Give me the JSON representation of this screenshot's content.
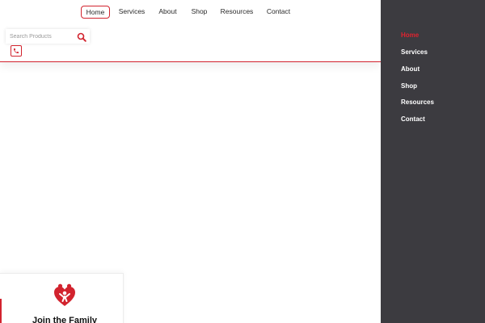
{
  "header": {
    "nav": [
      {
        "label": "Home",
        "active": true
      },
      {
        "label": "Services",
        "active": false
      },
      {
        "label": "About",
        "active": false
      },
      {
        "label": "Shop",
        "active": false
      },
      {
        "label": "Resources",
        "active": false
      },
      {
        "label": "Contact",
        "active": false
      }
    ],
    "search": {
      "placeholder": "Search Products",
      "value": "",
      "icon": "search-icon"
    },
    "phone_icon": "phone-icon"
  },
  "card": {
    "icon": "family-heart-icon",
    "title": "Join the Family"
  },
  "sidebar": {
    "items": [
      {
        "label": "Home",
        "active": true
      },
      {
        "label": "Services",
        "active": false
      },
      {
        "label": "About",
        "active": false
      },
      {
        "label": "Shop",
        "active": false
      },
      {
        "label": "Resources",
        "active": false
      },
      {
        "label": "Contact",
        "active": false
      }
    ]
  },
  "colors": {
    "accent": "#d2232e",
    "sidebar_bg": "#3c3b40",
    "sidebar_text": "#ffffff",
    "sidebar_active": "#e0232f",
    "header_bg": "#ffffff"
  }
}
